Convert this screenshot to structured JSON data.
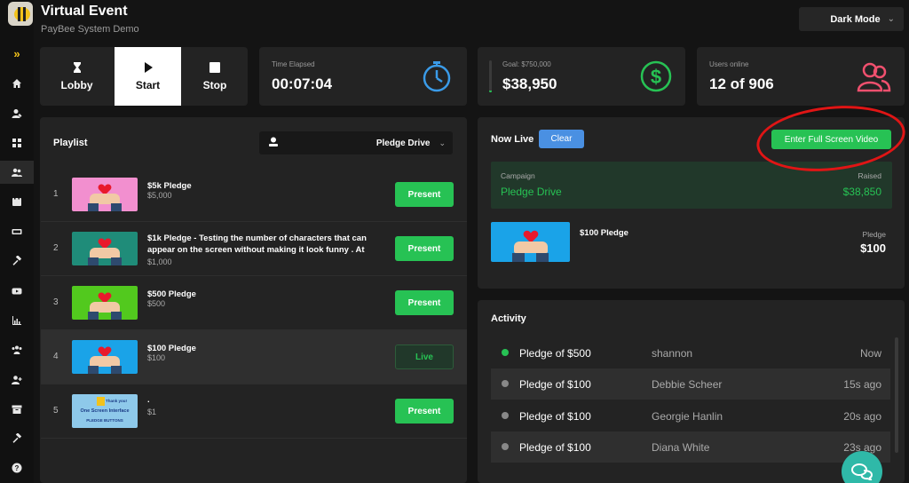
{
  "app": {
    "title": "Virtual Event",
    "subtitle": "PayBee System Demo"
  },
  "theme_select": {
    "value": "Dark Mode"
  },
  "sidebar": {
    "items": [
      "expand-icon",
      "home-icon",
      "user-edit-icon",
      "grid-icon",
      "users-icon",
      "calendar-icon",
      "ticket-icon",
      "gavel-icon",
      "youtube-icon",
      "chart-icon",
      "team-icon",
      "user-add-icon",
      "archive-icon",
      "tools-icon",
      "help-icon"
    ]
  },
  "controls": {
    "lobby": "Lobby",
    "start": "Start",
    "stop": "Stop"
  },
  "stats": {
    "elapsed": {
      "label": "Time Elapsed",
      "value": "00:07:04"
    },
    "goal": {
      "label": "Goal: $750,000",
      "value": "$38,950",
      "progress": 0.052
    },
    "users": {
      "label": "Users online",
      "value": "12 of 906"
    }
  },
  "playlist": {
    "title": "Playlist",
    "select": "Pledge Drive",
    "items": [
      {
        "num": "1",
        "title": "$5k Pledge",
        "sub": "$5,000",
        "action": "Present",
        "bg": "#f28fcf"
      },
      {
        "num": "2",
        "title": "$1k Pledge - Testing the number of characters that can appear on the screen without making it look funny . At",
        "sub": "$1,000",
        "action": "Present",
        "bg": "#1f8c79"
      },
      {
        "num": "3",
        "title": "$500 Pledge",
        "sub": "$500",
        "action": "Present",
        "bg": "#52c91e"
      },
      {
        "num": "4",
        "title": "$100 Pledge",
        "sub": "$100",
        "action": "Live",
        "bg": "#1aa3e8"
      },
      {
        "num": "5",
        "title": ".",
        "sub": "$1",
        "action": "Present",
        "thumb_lines": [
          "Thank you!",
          "One Screen Interface",
          "PLEDGE BUTTONS"
        ]
      }
    ]
  },
  "now_live": {
    "title": "Now Live",
    "clear": "Clear",
    "fullscreen": "Enter Full Screen Video",
    "campaign_label": "Campaign",
    "campaign_name": "Pledge Drive",
    "raised_label": "Raised",
    "raised_value": "$38,850",
    "item_name": "$100 Pledge",
    "pledge_label": "Pledge",
    "pledge_value": "$100"
  },
  "activity": {
    "title": "Activity",
    "rows": [
      {
        "text": "Pledge of $500",
        "name": "shannon",
        "time": "Now",
        "dot": "#27c254"
      },
      {
        "text": "Pledge of $100",
        "name": "Debbie Scheer",
        "time": "15s ago",
        "dot": "#888888"
      },
      {
        "text": "Pledge of $100",
        "name": "Georgie Hanlin",
        "time": "20s ago",
        "dot": "#888888"
      },
      {
        "text": "Pledge of $100",
        "name": "Diana White",
        "time": "23s ago",
        "dot": "#888888"
      }
    ]
  },
  "colors": {
    "accent_green": "#27c254",
    "accent_blue": "#4a90e2",
    "users_icon": "#f0506e",
    "annotation": "#e01515"
  }
}
